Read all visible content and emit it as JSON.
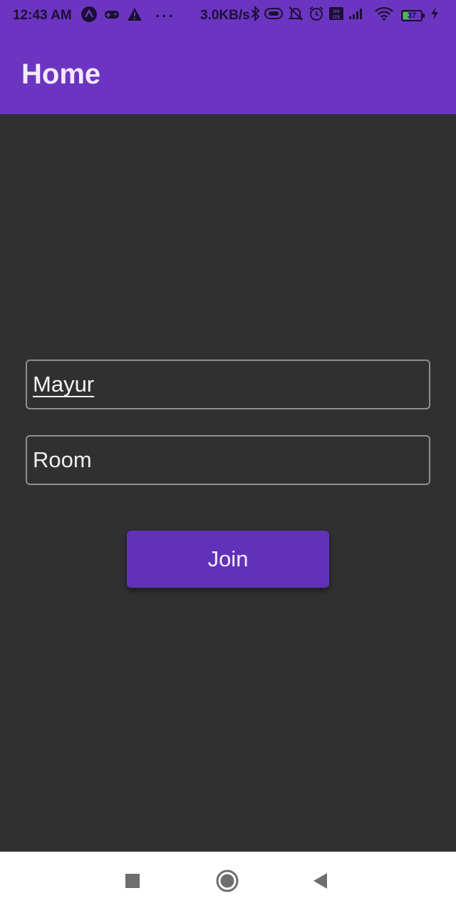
{
  "status_bar": {
    "time": "12:43 AM",
    "network_speed": "3.0KB/s",
    "more_indicator": "···",
    "battery_level": "37",
    "icons": [
      "app-icon",
      "game-controller-icon",
      "warning-icon",
      "bluetooth-icon",
      "toggle-icon",
      "alarm-off-icon",
      "alarm-icon",
      "volte-icon",
      "signal-icon",
      "wifi-icon",
      "battery-icon",
      "charging-icon"
    ],
    "text_color": "#1b1033"
  },
  "app_bar": {
    "title": "Home",
    "color": "#6c35c1"
  },
  "form": {
    "name_value": "Mayur",
    "room_placeholder": "Room",
    "join_label": "Join",
    "button_color": "#6231b9",
    "background": "#303030"
  },
  "nav_bar": {
    "buttons": [
      "recents-icon",
      "home-icon",
      "back-icon"
    ]
  }
}
